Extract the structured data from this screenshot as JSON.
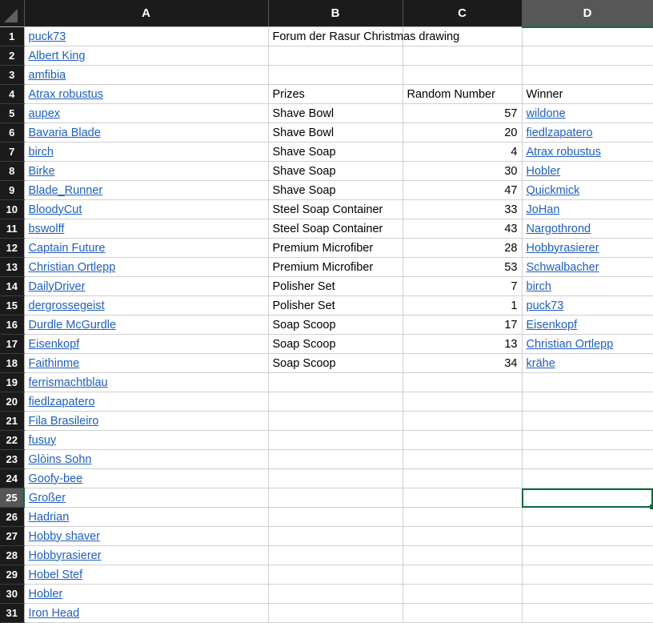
{
  "spreadsheet": {
    "corner_label": "select-all",
    "columns": [
      {
        "letter": "A",
        "active": false
      },
      {
        "letter": "B",
        "active": false
      },
      {
        "letter": "C",
        "active": false
      },
      {
        "letter": "D",
        "active": true
      }
    ],
    "active_cell": "D25",
    "accent_color": "#0d6b3f",
    "link_color": "#1f5fbf",
    "header_bg": "#1b1b1b",
    "header_active_bg": "#575757",
    "gridline_color": "#cfcfcf",
    "title": "Forum der Rasur Christmas drawing",
    "headers": {
      "prizes": "Prizes",
      "random_number": "Random Number",
      "winner": "Winner"
    },
    "rows": [
      {
        "n": "1",
        "a": "puck73",
        "a_link": true,
        "b": "Forum der Rasur Christmas drawing",
        "b_spill": true,
        "c": "",
        "d": "",
        "d_link": false
      },
      {
        "n": "2",
        "a": "Albert King",
        "a_link": true,
        "b": "",
        "c": "",
        "d": "",
        "d_link": false
      },
      {
        "n": "3",
        "a": "amfibia",
        "a_link": true,
        "b": "",
        "c": "",
        "d": "",
        "d_link": false
      },
      {
        "n": "4",
        "a": "Atrax robustus",
        "a_link": true,
        "b": "Prizes",
        "c": "Random Number",
        "c_align": "left",
        "d": "Winner",
        "d_link": false
      },
      {
        "n": "5",
        "a": "aupex",
        "a_link": true,
        "b": "Shave Bowl",
        "c": "57",
        "d": "wildone",
        "d_link": true
      },
      {
        "n": "6",
        "a": "Bavaria Blade",
        "a_link": true,
        "b": "Shave Bowl",
        "c": "20",
        "d": "fiedlzapatero",
        "d_link": true
      },
      {
        "n": "7",
        "a": "birch",
        "a_link": true,
        "b": "Shave Soap",
        "c": "4",
        "d": "Atrax robustus",
        "d_link": true
      },
      {
        "n": "8",
        "a": "Birke",
        "a_link": true,
        "b": "Shave Soap",
        "c": "30",
        "d": "Hobler",
        "d_link": true
      },
      {
        "n": "9",
        "a": "Blade_Runner",
        "a_link": true,
        "b": "Shave Soap",
        "c": "47",
        "d": "Quickmick",
        "d_link": true
      },
      {
        "n": "10",
        "a": "BloodyCut",
        "a_link": true,
        "b": "Steel Soap Container",
        "c": "33",
        "d": "JoHan",
        "d_link": true
      },
      {
        "n": "11",
        "a": "bswolff",
        "a_link": true,
        "b": "Steel Soap Container",
        "c": "43",
        "d": "Nargothrond",
        "d_link": true
      },
      {
        "n": "12",
        "a": "Captain Future",
        "a_link": true,
        "b": "Premium Microfiber",
        "c": "28",
        "d": "Hobbyrasierer",
        "d_link": true
      },
      {
        "n": "13",
        "a": "Christian Ortlepp",
        "a_link": true,
        "b": "Premium Microfiber",
        "c": "53",
        "d": "Schwalbacher",
        "d_link": true
      },
      {
        "n": "14",
        "a": "DailyDriver",
        "a_link": true,
        "b": "Polisher Set",
        "c": "7",
        "d": "birch",
        "d_link": true
      },
      {
        "n": "15",
        "a": "dergrossegeist",
        "a_link": true,
        "b": "Polisher Set",
        "c": "1",
        "d": "puck73",
        "d_link": true
      },
      {
        "n": "16",
        "a": "Durdle McGurdle",
        "a_link": true,
        "b": "Soap Scoop",
        "c": "17",
        "d": "Eisenkopf",
        "d_link": true
      },
      {
        "n": "17",
        "a": "Eisenkopf",
        "a_link": true,
        "b": "Soap Scoop",
        "c": "13",
        "d": "Christian Ortlepp",
        "d_link": true
      },
      {
        "n": "18",
        "a": "Faithinme",
        "a_link": true,
        "b": "Soap Scoop",
        "c": "34",
        "d": "krähe",
        "d_link": true
      },
      {
        "n": "19",
        "a": "ferrismachtblau",
        "a_link": true,
        "b": "",
        "c": "",
        "d": "",
        "d_link": false
      },
      {
        "n": "20",
        "a": "fiedlzapatero",
        "a_link": true,
        "b": "",
        "c": "",
        "d": "",
        "d_link": false
      },
      {
        "n": "21",
        "a": "Fila Brasileiro",
        "a_link": true,
        "b": "",
        "c": "",
        "d": "",
        "d_link": false
      },
      {
        "n": "22",
        "a": "fusuy",
        "a_link": true,
        "b": "",
        "c": "",
        "d": "",
        "d_link": false
      },
      {
        "n": "23",
        "a": "Glòins Sohn",
        "a_link": true,
        "b": "",
        "c": "",
        "d": "",
        "d_link": false
      },
      {
        "n": "24",
        "a": "Goofy-bee",
        "a_link": true,
        "b": "",
        "c": "",
        "d": "",
        "d_link": false
      },
      {
        "n": "25",
        "a": "Großer",
        "a_link": true,
        "b": "",
        "c": "",
        "d": "",
        "d_link": false,
        "active": true
      },
      {
        "n": "26",
        "a": "Hadrian",
        "a_link": true,
        "b": "",
        "c": "",
        "d": "",
        "d_link": false
      },
      {
        "n": "27",
        "a": "Hobby shaver",
        "a_link": true,
        "b": "",
        "c": "",
        "d": "",
        "d_link": false
      },
      {
        "n": "28",
        "a": "Hobbyrasierer",
        "a_link": true,
        "b": "",
        "c": "",
        "d": "",
        "d_link": false
      },
      {
        "n": "29",
        "a": "Hobel Stef",
        "a_link": true,
        "b": "",
        "c": "",
        "d": "",
        "d_link": false
      },
      {
        "n": "30",
        "a": "Hobler",
        "a_link": true,
        "b": "",
        "c": "",
        "d": "",
        "d_link": false
      },
      {
        "n": "31",
        "a": "Iron Head",
        "a_link": true,
        "b": "",
        "c": "",
        "d": "",
        "d_link": false
      }
    ]
  }
}
